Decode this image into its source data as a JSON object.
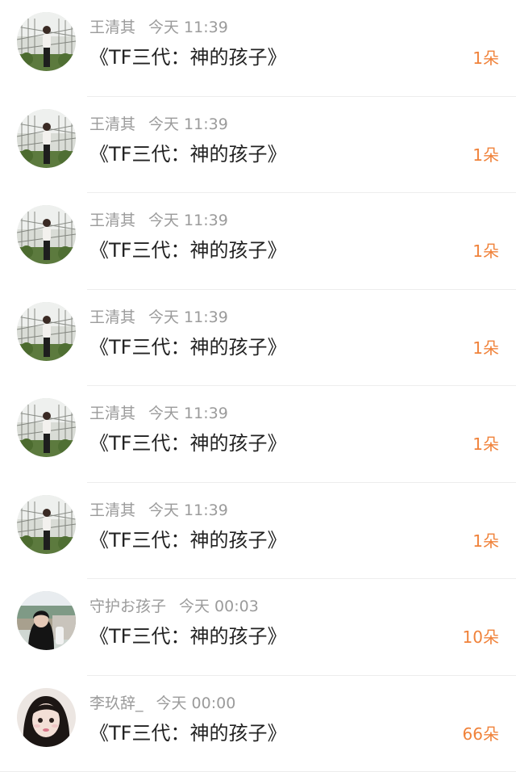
{
  "colors": {
    "name_text": "#9b9b9b",
    "title_text": "#222222",
    "count_text": "#f0823a",
    "divider": "#ededed",
    "background": "#ffffff"
  },
  "rows": [
    {
      "name": "王清其",
      "time": "今天 11:39",
      "title": "《TF三代：神的孩子》",
      "count": "1朵",
      "avatar_icon": "avatar-girl-garden"
    },
    {
      "name": "王清其",
      "time": "今天 11:39",
      "title": "《TF三代：神的孩子》",
      "count": "1朵",
      "avatar_icon": "avatar-girl-garden"
    },
    {
      "name": "王清其",
      "time": "今天 11:39",
      "title": "《TF三代：神的孩子》",
      "count": "1朵",
      "avatar_icon": "avatar-girl-garden"
    },
    {
      "name": "王清其",
      "time": "今天 11:39",
      "title": "《TF三代：神的孩子》",
      "count": "1朵",
      "avatar_icon": "avatar-girl-garden"
    },
    {
      "name": "王清其",
      "time": "今天 11:39",
      "title": "《TF三代：神的孩子》",
      "count": "1朵",
      "avatar_icon": "avatar-girl-garden"
    },
    {
      "name": "王清其",
      "time": "今天 11:39",
      "title": "《TF三代：神的孩子》",
      "count": "1朵",
      "avatar_icon": "avatar-girl-garden"
    },
    {
      "name": "守护お孩子",
      "time": "今天 00:03",
      "title": "《TF三代：神的孩子》",
      "count": "10朵",
      "avatar_icon": "avatar-girl-outdoor"
    },
    {
      "name": "李玖辞_",
      "time": "今天 00:00",
      "title": "《TF三代：神的孩子》",
      "count": "66朵",
      "avatar_icon": "avatar-girl-portrait"
    }
  ]
}
